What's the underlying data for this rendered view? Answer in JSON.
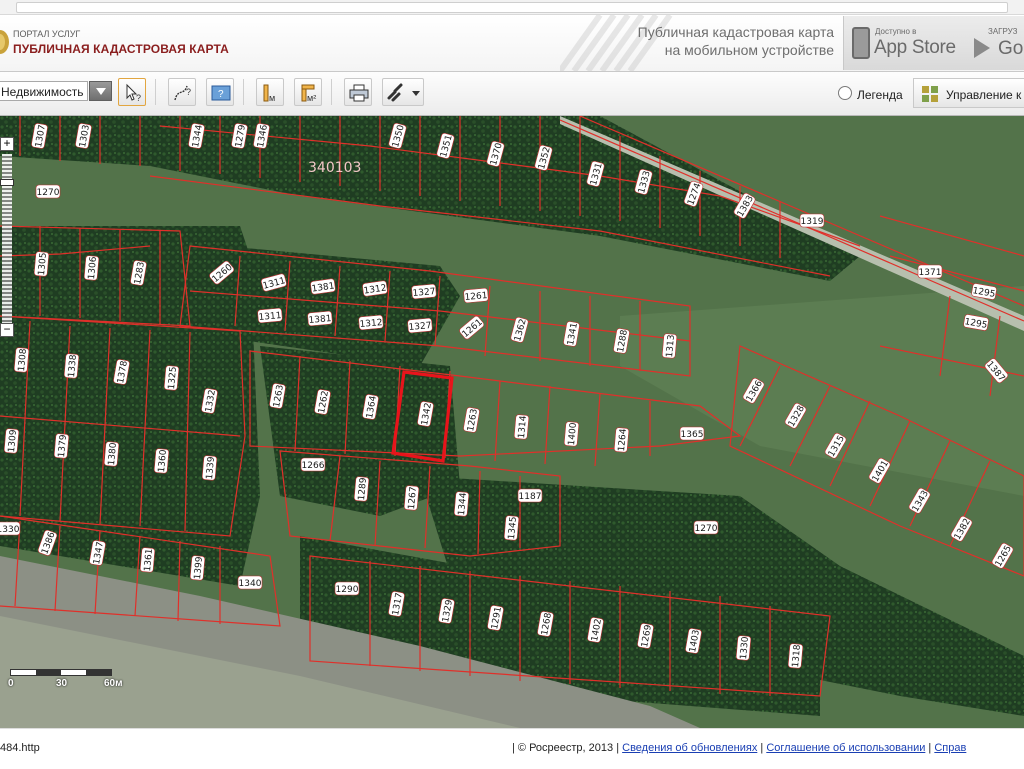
{
  "header": {
    "portal_small": "ПОРТАЛ УСЛУГ",
    "portal_title": "ПУБЛИЧНАЯ КАДАСТРОВАЯ КАРТА",
    "promo_line1": "Публичная кадастровая карта",
    "promo_line2": "на мобильном устройстве",
    "appstore_small": "Доступно в",
    "appstore_big": "App Store",
    "gplay_small": "ЗАГРУЗ",
    "gplay_big": "Goo"
  },
  "toolbar": {
    "layer_select": "Недвижимость",
    "legend_label": "Легенда",
    "manage_label": "Управление к",
    "buttons": [
      "identify-button",
      "measure-path-button",
      "select-area-button",
      "measure-length-button",
      "measure-area-button",
      "print-button",
      "link-button"
    ]
  },
  "map": {
    "quarter_label": "340103",
    "parcel_labels": [
      "1307",
      "1303",
      "1344",
      "1279",
      "1346",
      "1350",
      "1351",
      "1370",
      "1352",
      "1331",
      "1333",
      "1274",
      "1383",
      "1319",
      "1270",
      "1305",
      "1306",
      "1283",
      "1260",
      "1311",
      "1381",
      "1312",
      "1327",
      "1261",
      "1311",
      "1381",
      "1312",
      "1327",
      "1261",
      "1362",
      "1341",
      "1288",
      "1313",
      "1371",
      "1295",
      "1295",
      "1387",
      "1308",
      "1338",
      "1378",
      "1325",
      "1332",
      "1263",
      "1262",
      "1364",
      "1342",
      "1263",
      "1314",
      "1400",
      "1264",
      "1365",
      "1366",
      "1328",
      "1315",
      "1401",
      "1343",
      "1382",
      "1309",
      "1379",
      "1380",
      "1360",
      "1339",
      "1266",
      "1289",
      "1267",
      "1344",
      "1187",
      "1345",
      "1270",
      "1265",
      "1330",
      "1386",
      "1347",
      "1361",
      "1399",
      "1340",
      "1290",
      "1317",
      "1329",
      "1291",
      "1268",
      "1402",
      "1269",
      "1403",
      "1330",
      "1318"
    ],
    "selected_parcel": "1342",
    "scale_labels": [
      "0",
      "30",
      "60м"
    ],
    "colors": {
      "boundary": "#e0302a",
      "selected": "#e8141b"
    }
  },
  "footer": {
    "left": "484.http",
    "copyright": "| © Росреестр, 2013 |",
    "link1": "Сведения об обновлениях",
    "sep1": "|",
    "link2": "Соглашение об использовании",
    "sep2": "|",
    "link3": "Справ"
  }
}
